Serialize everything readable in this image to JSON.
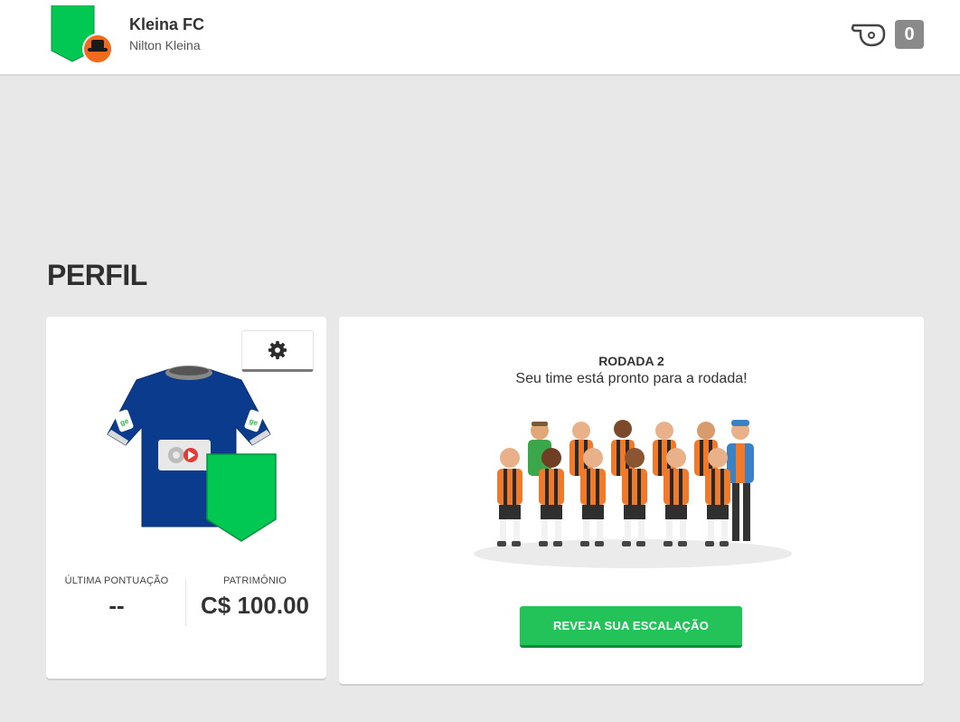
{
  "header": {
    "team_name": "Kleina FC",
    "owner_name": "Nilton Kleina",
    "notification_count": "0",
    "crest_color": "#00c853",
    "avatar_color": "#f26a1b"
  },
  "page": {
    "title": "PERFIL"
  },
  "profile": {
    "settings_icon": "gear-icon",
    "shirt_color": "#0b3b8c",
    "shirt_sponsor_badge": "ge",
    "stats": [
      {
        "label": "ÚLTIMA PONTUAÇÃO",
        "value": "--"
      },
      {
        "label": "PATRIMÔNIO",
        "value": "C$ 100.00"
      }
    ]
  },
  "round": {
    "title": "RODADA 2",
    "subtitle": "Seu time está pronto para a rodada!",
    "button_label": "REVEJA SUA ESCALAÇÃO",
    "button_color": "#23c35a"
  }
}
